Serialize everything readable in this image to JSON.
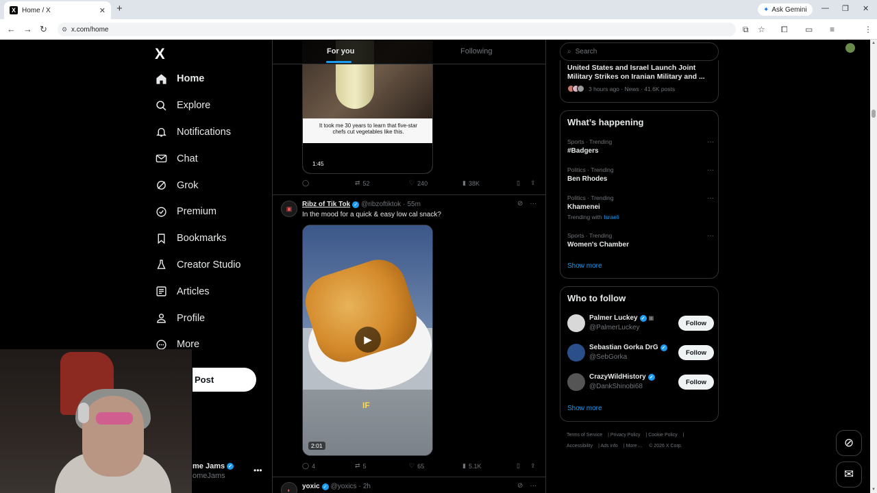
{
  "browser": {
    "tab_title": "Home / X",
    "tab_favicon": "X",
    "url": "x.com/home",
    "ask_gemini": "Ask Gemini"
  },
  "nav": {
    "logo": "X",
    "items": [
      {
        "label": "Home",
        "icon": "home-icon"
      },
      {
        "label": "Explore",
        "icon": "search-icon"
      },
      {
        "label": "Notifications",
        "icon": "bell-icon"
      },
      {
        "label": "Chat",
        "icon": "mail-icon"
      },
      {
        "label": "Grok",
        "icon": "grok-icon"
      },
      {
        "label": "Premium",
        "icon": "premium-icon"
      },
      {
        "label": "Bookmarks",
        "icon": "bookmark-icon"
      },
      {
        "label": "Creator Studio",
        "icon": "flask-icon"
      },
      {
        "label": "Articles",
        "icon": "article-icon"
      },
      {
        "label": "Profile",
        "icon": "person-icon"
      },
      {
        "label": "More",
        "icon": "more-circle-icon"
      }
    ],
    "post_label": "Post",
    "account_name": "me Jams",
    "account_handle": "omeJams"
  },
  "feed": {
    "tabs": [
      "For you",
      "Following"
    ],
    "tweet1": {
      "caption": "It took me 30 years to learn that five-star chefs cut vegetables like this.",
      "duration": "1:45",
      "replies": "",
      "reposts": "52",
      "likes": "240",
      "views": "38K"
    },
    "tweet2": {
      "name": "Ribz of Tik Tok",
      "handle": "@ribzoftiktok",
      "time": "55m",
      "text": "In the mood for a quick & easy low cal snack?",
      "video_overlay": "IF",
      "duration": "2:01",
      "replies": "4",
      "reposts": "5",
      "likes": "65",
      "views": "5.1K"
    },
    "tweet3": {
      "name": "yoxic",
      "handle": "@yoxics",
      "time": "2h"
    }
  },
  "sidebar": {
    "search_placeholder": "Search",
    "news": {
      "headline": "United States and Israel Launch Joint Military Strikes on Iranian Military and ...",
      "meta": "3 hours ago · News · 41.6K posts"
    },
    "happening_title": "What’s happening",
    "trends": [
      {
        "category": "Sports · Trending",
        "name": "#Badgers",
        "with": ""
      },
      {
        "category": "Politics · Trending",
        "name": "Ben Rhodes",
        "with": ""
      },
      {
        "category": "Politics · Trending",
        "name": "Khamenei",
        "with_prefix": "Trending with",
        "with": "Israeli"
      },
      {
        "category": "Sports · Trending",
        "name": "Women's Chamber",
        "with": ""
      }
    ],
    "show_more": "Show more",
    "who_title": "Who to follow",
    "who": [
      {
        "name": "Palmer Luckey",
        "handle": "@PalmerLuckey",
        "button": "Follow"
      },
      {
        "name": "Sebastian Gorka DrG",
        "handle": "@SebGorka",
        "button": "Follow"
      },
      {
        "name": "CrazyWildHistory",
        "handle": "@DankShinobi68",
        "button": "Follow"
      }
    ],
    "footer": [
      "Terms of Service",
      "Privacy Policy",
      "Cookie Policy",
      "Accessibility",
      "Ads info",
      "More ...",
      "© 2026 X Corp."
    ]
  },
  "colors": {
    "background": "#000000",
    "accent": "#1d9bf0",
    "text": "#e7e9ea",
    "muted": "#71767b"
  }
}
